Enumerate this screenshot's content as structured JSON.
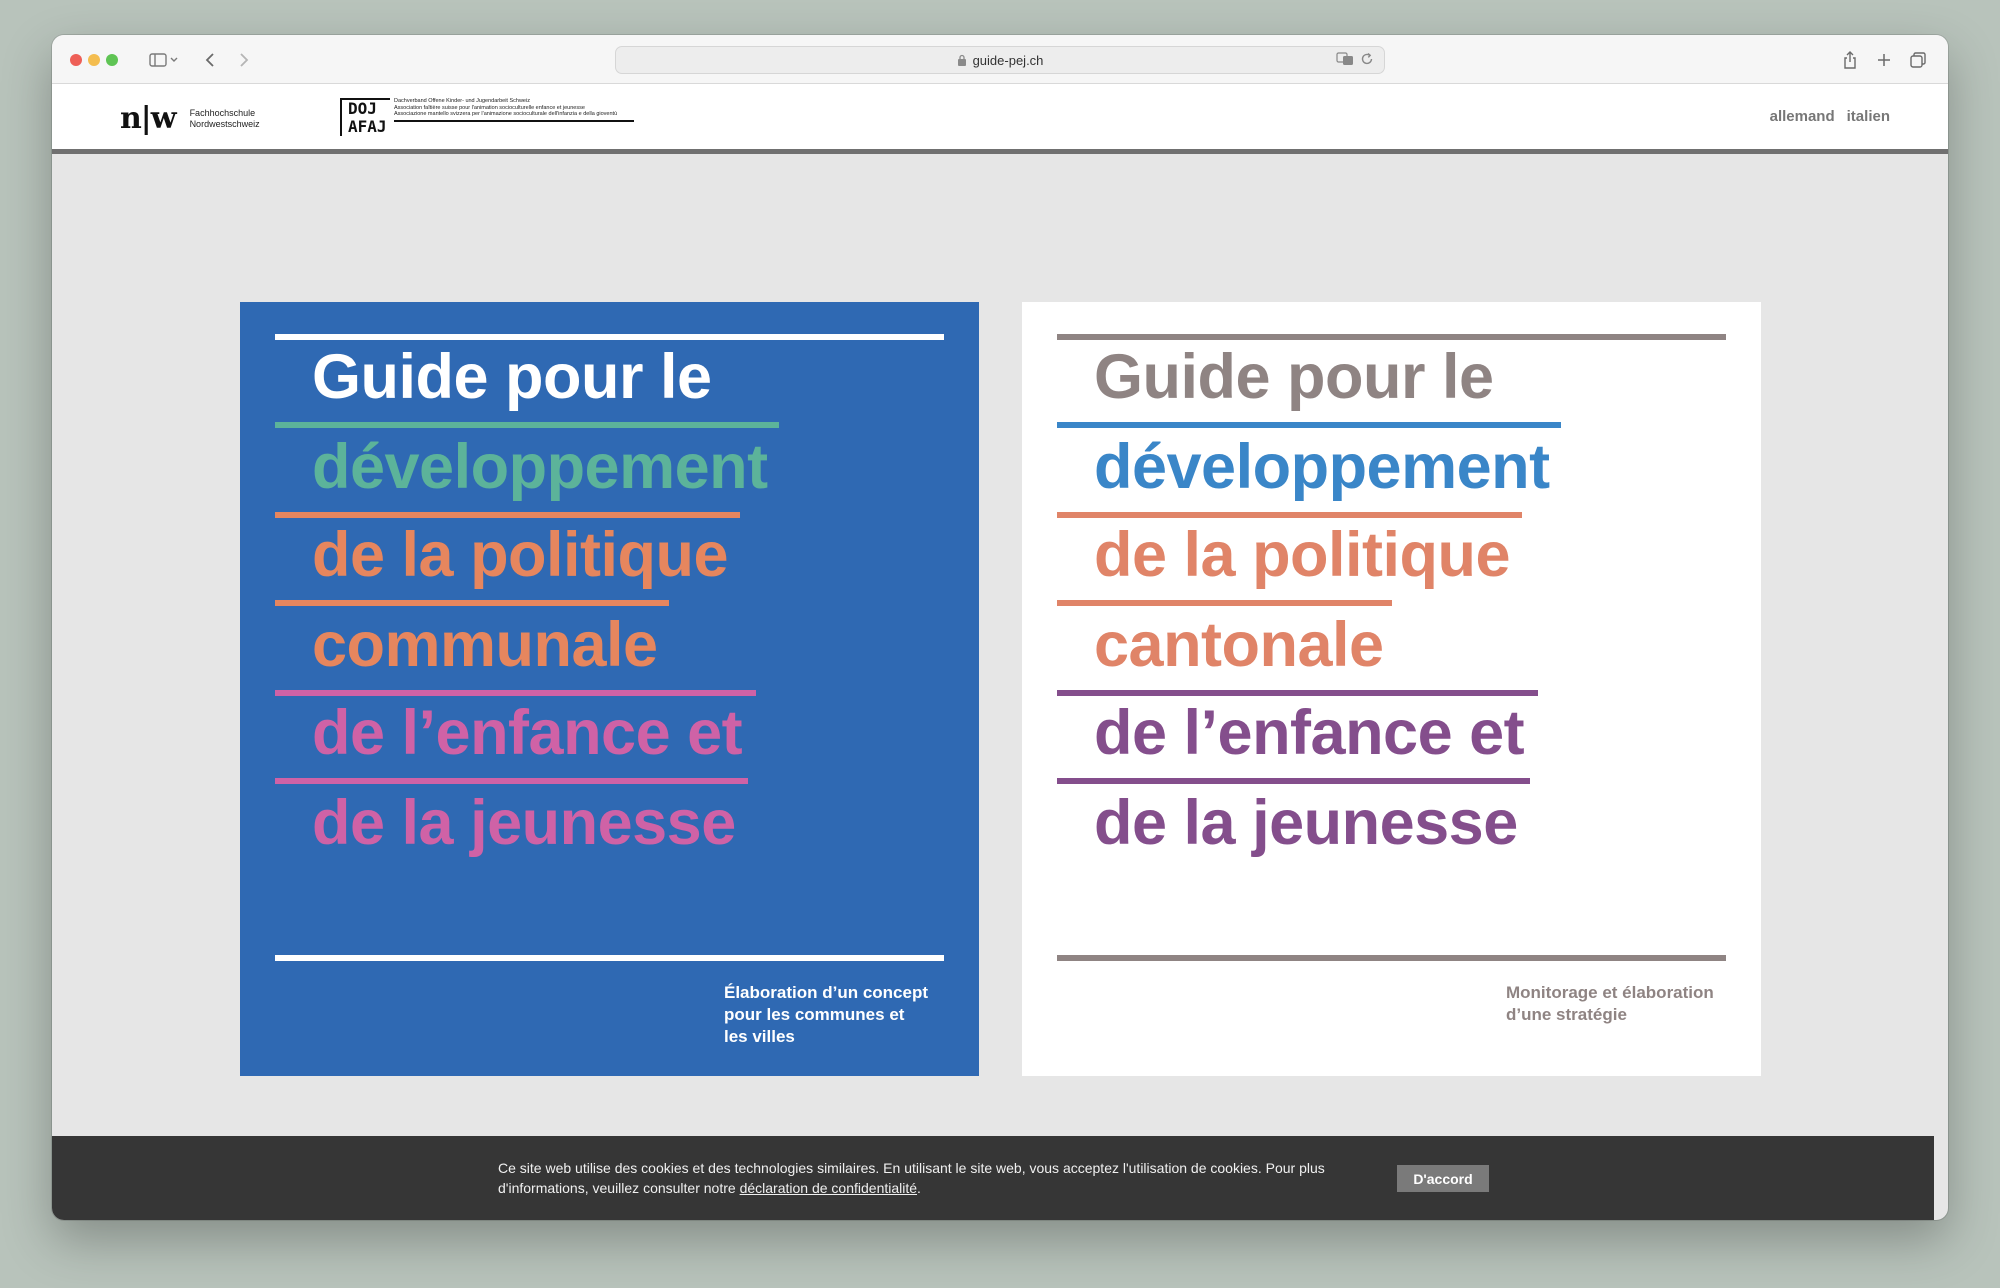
{
  "browser": {
    "url": "guide-pej.ch"
  },
  "header": {
    "fhnw_logo_mark": "n|w",
    "fhnw_line1": "Fachhochschule",
    "fhnw_line2": "Nordwestschweiz",
    "doj_logo_mark_top": "DOJ",
    "doj_logo_mark_bottom": "AFAJ",
    "doj_line1": "Dachverband Offene Kinder- und Jugendarbeit Schweiz",
    "doj_line2": "Association faîtière suisse pour l'animation socioculturelle enfance et jeunesse",
    "doj_line3": "Associazione mantello svizzera per l'animazione socioculturale dell'infanzia e della gioventù",
    "lang_links": [
      "allemand",
      "italien"
    ]
  },
  "covers": {
    "communal": {
      "lines": [
        "Guide pour le",
        "développement",
        "de la politique",
        "communale",
        "de l’enfance et",
        "de la jeunesse"
      ],
      "subtitle": [
        "Élaboration d’un concept",
        "pour les communes et",
        "les villes"
      ],
      "colors": {
        "background": "#2f69b3",
        "frame": "#ffffff",
        "text": [
          "#ffffff",
          "#5cb39a",
          "#e6865e",
          "#e6865e",
          "#cf62a6",
          "#cf62a6"
        ],
        "subtitle": "#ffffff"
      }
    },
    "cantonal": {
      "lines": [
        "Guide pour le",
        "développement",
        "de la politique",
        "cantonale",
        "de l’enfance et",
        "de la jeunesse"
      ],
      "subtitle": [
        "Monitorage et élaboration",
        "d’une stratégie"
      ],
      "colors": {
        "background": "#ffffff",
        "frame": "#8f8483",
        "text": [
          "#8f8483",
          "#3a86c8",
          "#e08468",
          "#e08468",
          "#844e8c",
          "#844e8c"
        ],
        "subtitle": "#8f8483"
      }
    }
  },
  "cookie_banner": {
    "text_line1": "Ce site web utilise des cookies et des technologies similaires. En utilisant le site web, vous acceptez l'utilisation de cookies. Pour plus",
    "text_line2_prefix": "d'informations, veuillez consulter notre ",
    "link_text": "déclaration de confidentialité",
    "text_line2_suffix": ".",
    "button_label": "D'accord"
  }
}
